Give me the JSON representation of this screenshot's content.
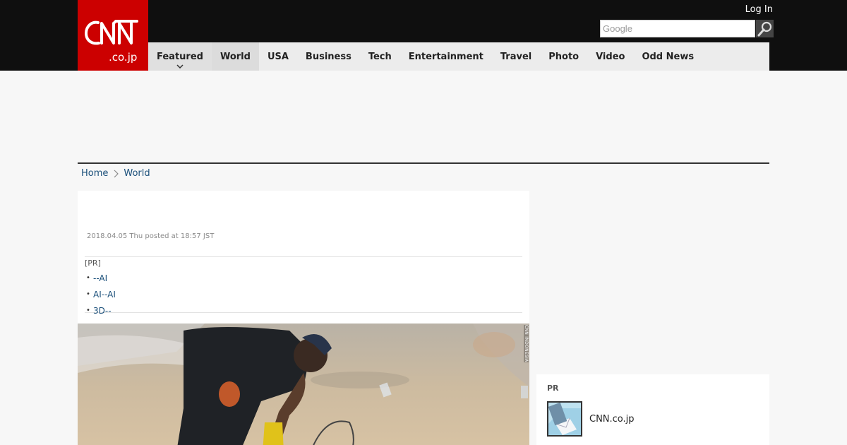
{
  "header": {
    "logo_main": "CNN",
    "logo_sub": ".co.jp",
    "login_label": "Log In",
    "search_placeholder": "Google",
    "search_icon": "magnifier-icon"
  },
  "nav": {
    "items": [
      {
        "label": "Featured"
      },
      {
        "label": "World"
      },
      {
        "label": "USA"
      },
      {
        "label": "Business"
      },
      {
        "label": "Tech"
      },
      {
        "label": "Entertainment"
      },
      {
        "label": "Travel"
      },
      {
        "label": "Photo"
      },
      {
        "label": "Video"
      },
      {
        "label": "Odd News"
      }
    ],
    "active": "World"
  },
  "breadcrumb": {
    "home": "Home",
    "current": "World"
  },
  "article": {
    "posted": "2018.04.05 Thu posted at 18:57 JST",
    "pr_label": "[PR]",
    "pr_links": [
      "--AI",
      "AI--AI",
      "3D--"
    ],
    "photo_credit": "CNN INDONESIA"
  },
  "sidebar": {
    "pr_label": "PR",
    "pr_item_text": "CNN.co.jp"
  },
  "colors": {
    "brand_red": "#cc0000",
    "header_black": "#0f0f0f",
    "link_blue": "#1a4f7a"
  }
}
